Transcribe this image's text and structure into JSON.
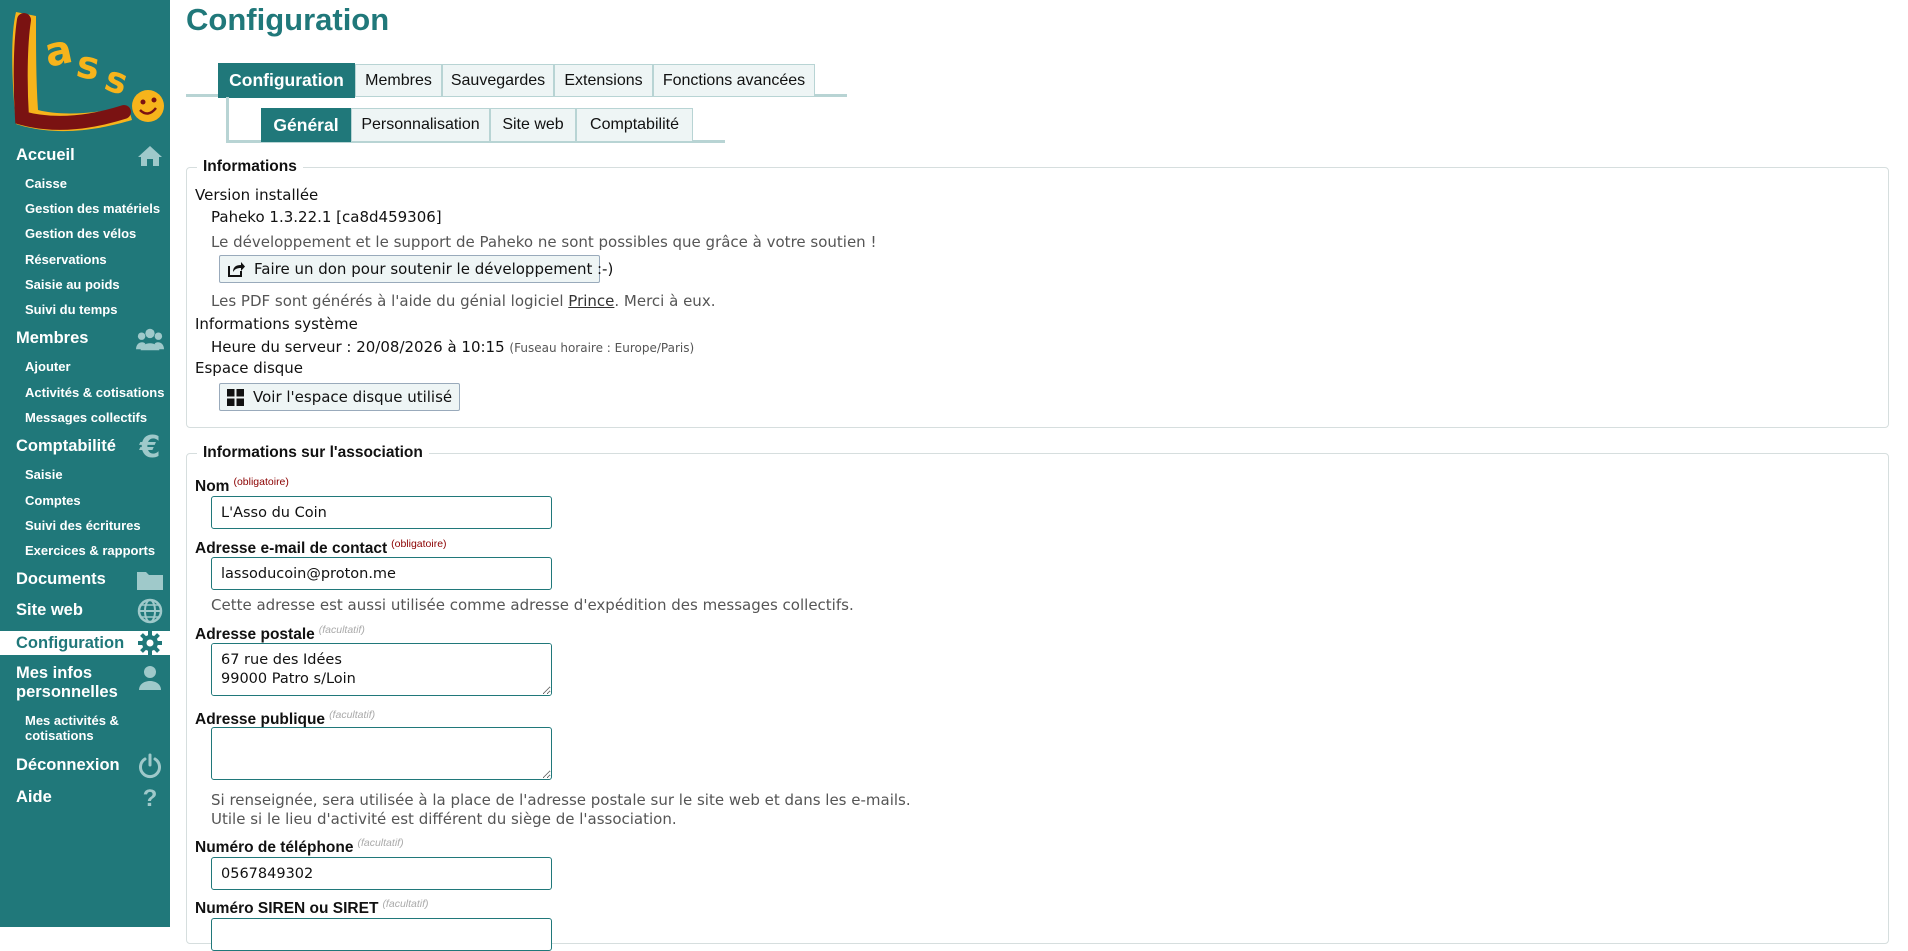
{
  "page": {
    "title": "Configuration"
  },
  "sidebar": {
    "items": [
      {
        "label": "Accueil",
        "icon": "home-icon"
      },
      {
        "label": "Membres",
        "icon": "users-icon"
      },
      {
        "label": "Comptabilité",
        "icon": "euro-icon"
      },
      {
        "label": "Documents",
        "icon": "folder-icon"
      },
      {
        "label": "Site web",
        "icon": "globe-icon"
      },
      {
        "label": "Configuration",
        "icon": "gear-icon"
      },
      {
        "label": "Mes infos personnelles",
        "icon": "user-icon"
      },
      {
        "label": "Déconnexion",
        "icon": "power-icon"
      },
      {
        "label": "Aide",
        "icon": "help-icon"
      }
    ],
    "sub": {
      "accueil": [
        "Caisse",
        "Gestion des matériels",
        "Gestion des vélos",
        "Réservations",
        "Saisie au poids",
        "Suivi du temps"
      ],
      "membres": [
        "Ajouter",
        "Activités & cotisations",
        "Messages collectifs"
      ],
      "comptabilite": [
        "Saisie",
        "Comptes",
        "Suivi des écritures",
        "Exercices & rapports"
      ],
      "mesinfos": [
        "Mes activités & cotisations"
      ]
    }
  },
  "tabs": {
    "main": [
      "Configuration",
      "Membres",
      "Sauvegardes",
      "Extensions",
      "Fonctions avancées"
    ],
    "sub": [
      "Général",
      "Personnalisation",
      "Site web",
      "Comptabilité"
    ]
  },
  "info": {
    "legend": "Informations",
    "version_label": "Version installée",
    "version_value": "Paheko 1.3.22.1 [ca8d459306]",
    "support_text": "Le développement et le support de Paheko ne sont possibles que grâce à votre soutien !",
    "donate_button": "Faire un don pour soutenir le développement",
    "smiley": ":-)",
    "pdf_text_before": "Les PDF sont générés à l'aide du génial logiciel",
    "pdf_link": "Prince",
    "pdf_text_after": ". Merci à eux.",
    "system_label": "Informations système",
    "server_time": "Heure du serveur : 20/08/2026 à 10:15",
    "timezone": "(Fuseau horaire : Europe/Paris)",
    "disk_label": "Espace disque",
    "disk_button": "Voir l'espace disque utilisé"
  },
  "assoc": {
    "legend": "Informations sur l'association",
    "required": "(obligatoire)",
    "optional": "(facultatif)",
    "name_label": "Nom",
    "name_value": "L'Asso du Coin",
    "email_label": "Adresse e-mail de contact",
    "email_value": "lassoducoin@proton.me",
    "email_help": "Cette adresse est aussi utilisée comme adresse d'expédition des messages collectifs.",
    "postal_label": "Adresse postale",
    "postal_value": "67 rue des Idées\n99000 Patro s/Loin",
    "public_label": "Adresse publique",
    "public_value": "",
    "public_help_1": "Si renseignée, sera utilisée à la place de l'adresse postale sur le site web et dans les e-mails.",
    "public_help_2": "Utile si le lieu d'activité est différent du siège de l'association.",
    "phone_label": "Numéro de téléphone",
    "phone_value": "0567849302",
    "siren_label": "Numéro SIREN ou SIRET",
    "siren_value": ""
  },
  "colors": {
    "brand": "#20787a",
    "tab_bg": "#eef5f5",
    "border": "#b8d4d4"
  }
}
